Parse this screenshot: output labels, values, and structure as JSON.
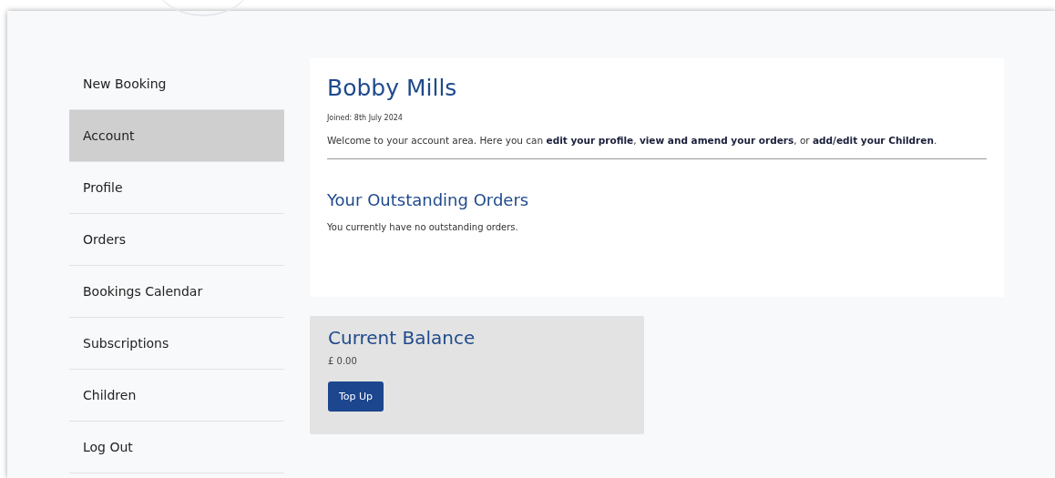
{
  "sidebar": {
    "items": [
      {
        "label": "New Booking",
        "selected": false
      },
      {
        "label": "Account",
        "selected": true
      },
      {
        "label": "Profile",
        "selected": false
      },
      {
        "label": "Orders",
        "selected": false
      },
      {
        "label": "Bookings Calendar",
        "selected": false
      },
      {
        "label": "Subscriptions",
        "selected": false
      },
      {
        "label": "Children",
        "selected": false
      },
      {
        "label": "Log Out",
        "selected": false
      }
    ]
  },
  "account": {
    "name": "Bobby Mills",
    "joined": "Joined: 8th July 2024",
    "welcome": "Welcome to your account area. Here you can **edit your profile**, **view and amend your orders**, or **add/edit your Children**.",
    "orders_heading": "Your Outstanding Orders",
    "orders_message": "You currently have no outstanding orders."
  },
  "balance": {
    "heading": "Current Balance",
    "amount": "£ 0.00",
    "button": "Top Up"
  }
}
